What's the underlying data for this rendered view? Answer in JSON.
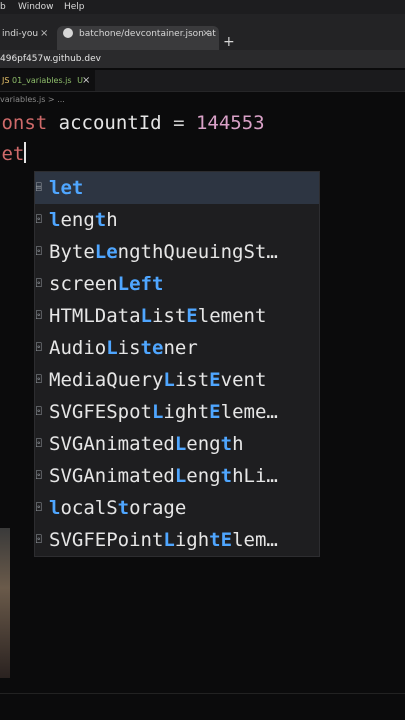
{
  "menubar": {
    "item1": "b",
    "item2": "Window",
    "item3": "Help"
  },
  "browser": {
    "tabs": [
      {
        "label": "indi-you",
        "close": "×"
      },
      {
        "label": "batchone/devcontainer.json at",
        "close": "×"
      }
    ],
    "new_tab": "+",
    "address": "496pf457w.github.dev"
  },
  "editor": {
    "tab": {
      "icon": "JS",
      "name": "01_variables.js",
      "modified": "U",
      "close": "×"
    },
    "breadcrumb": "variables.js > ...",
    "lines": [
      {
        "keyword": "const",
        "identifier": "accountId",
        "operator": "=",
        "number": "144553"
      },
      {
        "typed": "let"
      }
    ]
  },
  "suggestions": [
    {
      "parts": [
        [
          "let",
          true
        ]
      ]
    },
    {
      "parts": [
        [
          "l",
          true
        ],
        [
          "eng",
          false
        ],
        [
          "t",
          true
        ],
        [
          "h",
          false
        ]
      ]
    },
    {
      "parts": [
        [
          "Byte",
          false
        ],
        [
          "Le",
          true
        ],
        [
          "ngth",
          false
        ],
        [
          "QueuingSt…",
          false
        ]
      ]
    },
    {
      "parts": [
        [
          "screen",
          false
        ],
        [
          "Left",
          true
        ]
      ]
    },
    {
      "parts": [
        [
          "HTMLData",
          false
        ],
        [
          "L",
          true
        ],
        [
          "ist",
          false
        ],
        [
          "E",
          true
        ],
        [
          "lement",
          false
        ]
      ]
    },
    {
      "parts": [
        [
          "Audio",
          false
        ],
        [
          "L",
          true
        ],
        [
          "is",
          false
        ],
        [
          "te",
          true
        ],
        [
          "ner",
          false
        ]
      ]
    },
    {
      "parts": [
        [
          "MediaQuery",
          false
        ],
        [
          "L",
          true
        ],
        [
          "ist",
          false
        ],
        [
          "E",
          true
        ],
        [
          "vent",
          false
        ]
      ]
    },
    {
      "parts": [
        [
          "SVGFESpot",
          false
        ],
        [
          "L",
          true
        ],
        [
          "ight",
          false
        ],
        [
          "E",
          true
        ],
        [
          "leme…",
          false
        ]
      ]
    },
    {
      "parts": [
        [
          "SVGAnimated",
          false
        ],
        [
          "L",
          true
        ],
        [
          "eng",
          false
        ],
        [
          "t",
          true
        ],
        [
          "h",
          false
        ]
      ]
    },
    {
      "parts": [
        [
          "SVGAnimated",
          false
        ],
        [
          "L",
          true
        ],
        [
          "eng",
          false
        ],
        [
          "t",
          true
        ],
        [
          "hLi…",
          false
        ]
      ]
    },
    {
      "parts": [
        [
          "l",
          true
        ],
        [
          "ocalS",
          false
        ],
        [
          "t",
          true
        ],
        [
          "orage",
          false
        ]
      ]
    },
    {
      "parts": [
        [
          "SVGFEPoint",
          false
        ],
        [
          "L",
          true
        ],
        [
          "igh",
          false
        ],
        [
          "tE",
          true
        ],
        [
          "lem…",
          false
        ]
      ]
    }
  ],
  "colors": {
    "highlight": "#4fa6ff",
    "keyword": "#d06a6a",
    "number": "#d9a1c7"
  }
}
